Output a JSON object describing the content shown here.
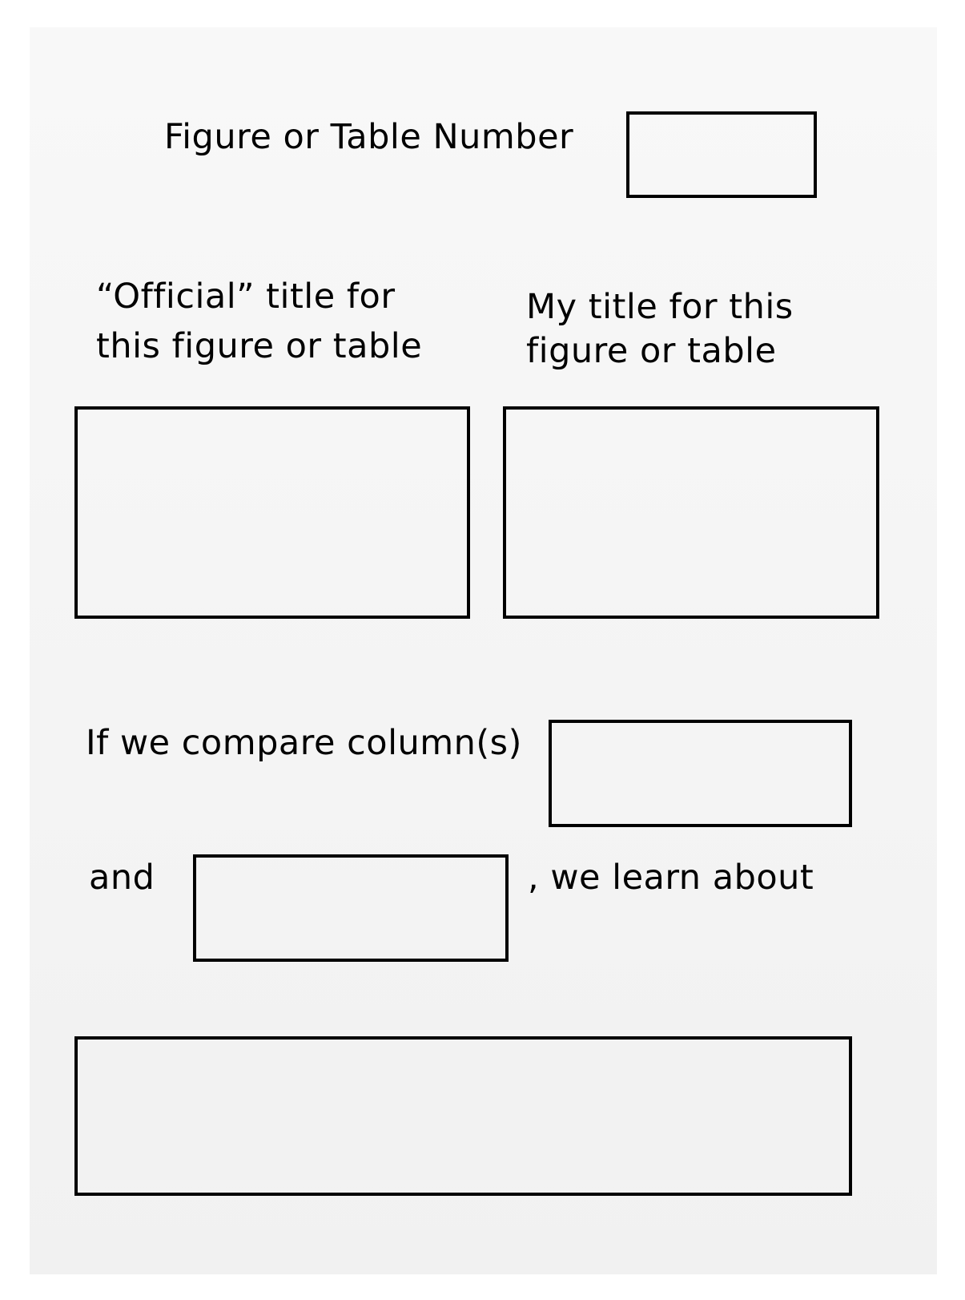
{
  "worksheet": {
    "figure_number_label": "Figure or Table Number",
    "official_title_label": "“Official” title for\nthis figure or table",
    "my_title_label": "My title for this\nfigure or table",
    "compare_label": "If we compare column(s)",
    "and_label": "and",
    "learn_label": ", we learn about"
  }
}
